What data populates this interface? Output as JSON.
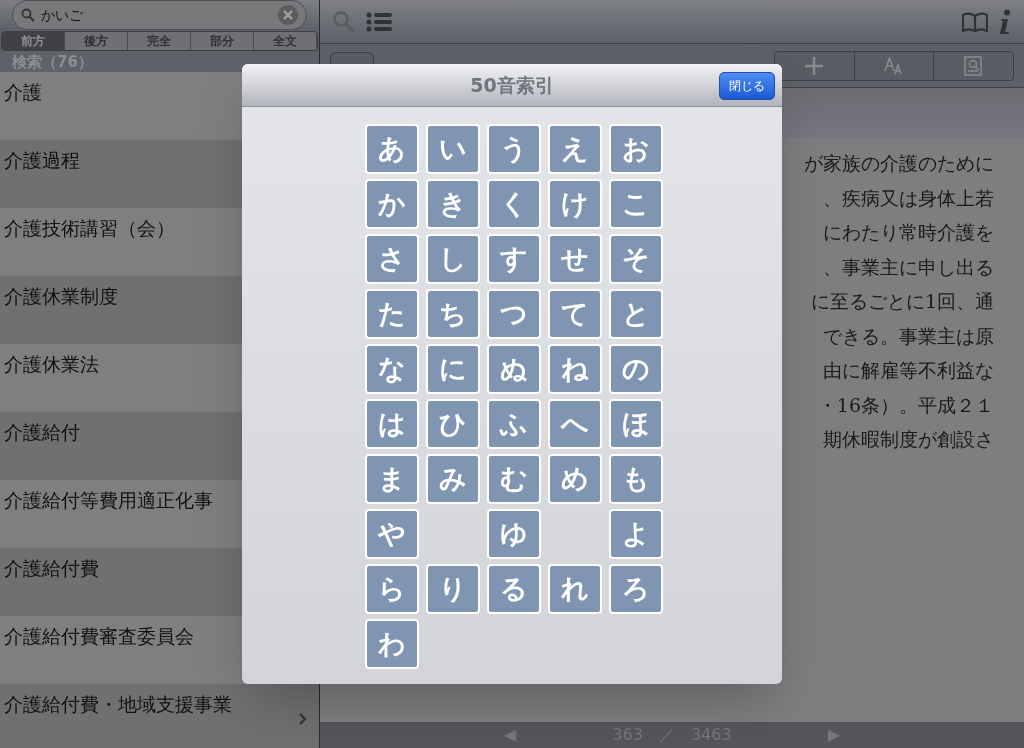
{
  "search": {
    "value": "かいご"
  },
  "scope_tabs": [
    {
      "label": "前方",
      "selected": true
    },
    {
      "label": "後方",
      "selected": false
    },
    {
      "label": "完全",
      "selected": false
    },
    {
      "label": "部分",
      "selected": false
    },
    {
      "label": "全文",
      "selected": false
    }
  ],
  "results_header": "検索（76）",
  "results": [
    {
      "label": "介護"
    },
    {
      "label": "介護過程"
    },
    {
      "label": "介護技術講習（会）"
    },
    {
      "label": "介護休業制度"
    },
    {
      "label": "介護休業法"
    },
    {
      "label": "介護給付"
    },
    {
      "label": "介護給付等費用適正化事"
    },
    {
      "label": "介護給付費"
    },
    {
      "label": "介護給付費審査委員会"
    },
    {
      "label": "介護給付費・地域支援事業"
    }
  ],
  "article_lines": [
    "が家族の介護のために",
    "、疾病又は身体上若",
    "にわたり常時介護を",
    "、事業主に申し出る",
    "に至るごとに1回、通",
    "できる。事業主は原",
    "由に解雇等不利益な",
    "・16条）。平成２１",
    "期休暇制度が創設さ"
  ],
  "pager": {
    "prev": "◀",
    "current": "363",
    "separator": "／",
    "total": "3463",
    "next": "▶"
  },
  "modal": {
    "title": "50音索引",
    "close_button": "閉じる",
    "rows": [
      [
        {
          "kind": "key",
          "label": "あ"
        },
        {
          "kind": "key",
          "label": "い"
        },
        {
          "kind": "key",
          "label": "う"
        },
        {
          "kind": "key",
          "label": "え"
        },
        {
          "kind": "key",
          "label": "お"
        }
      ],
      [
        {
          "kind": "key",
          "label": "か"
        },
        {
          "kind": "key",
          "label": "き"
        },
        {
          "kind": "key",
          "label": "く"
        },
        {
          "kind": "key",
          "label": "け"
        },
        {
          "kind": "key",
          "label": "こ"
        }
      ],
      [
        {
          "kind": "key",
          "label": "さ"
        },
        {
          "kind": "key",
          "label": "し"
        },
        {
          "kind": "key",
          "label": "す"
        },
        {
          "kind": "key",
          "label": "せ"
        },
        {
          "kind": "key",
          "label": "そ"
        }
      ],
      [
        {
          "kind": "key",
          "label": "た"
        },
        {
          "kind": "key",
          "label": "ち"
        },
        {
          "kind": "key",
          "label": "つ"
        },
        {
          "kind": "key",
          "label": "て"
        },
        {
          "kind": "key",
          "label": "と"
        }
      ],
      [
        {
          "kind": "key",
          "label": "な"
        },
        {
          "kind": "key",
          "label": "に"
        },
        {
          "kind": "key",
          "label": "ぬ"
        },
        {
          "kind": "key",
          "label": "ね"
        },
        {
          "kind": "key",
          "label": "の"
        }
      ],
      [
        {
          "kind": "key",
          "label": "は"
        },
        {
          "kind": "key",
          "label": "ひ"
        },
        {
          "kind": "key",
          "label": "ふ"
        },
        {
          "kind": "key",
          "label": "へ"
        },
        {
          "kind": "key",
          "label": "ほ"
        }
      ],
      [
        {
          "kind": "key",
          "label": "ま"
        },
        {
          "kind": "key",
          "label": "み"
        },
        {
          "kind": "key",
          "label": "む"
        },
        {
          "kind": "key",
          "label": "め"
        },
        {
          "kind": "key",
          "label": "も"
        }
      ],
      [
        {
          "kind": "key",
          "label": "や"
        },
        {
          "kind": "blank"
        },
        {
          "kind": "key",
          "label": "ゆ"
        },
        {
          "kind": "blank"
        },
        {
          "kind": "key",
          "label": "よ"
        }
      ],
      [
        {
          "kind": "key",
          "label": "ら"
        },
        {
          "kind": "key",
          "label": "り"
        },
        {
          "kind": "key",
          "label": "る"
        },
        {
          "kind": "key",
          "label": "れ"
        },
        {
          "kind": "key",
          "label": "ろ"
        }
      ],
      [
        {
          "kind": "key",
          "label": "わ"
        }
      ]
    ]
  }
}
